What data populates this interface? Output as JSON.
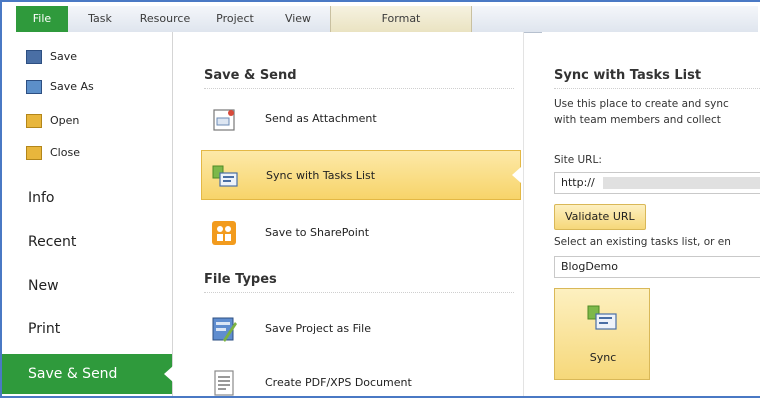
{
  "ribbon": {
    "tabs": [
      "File",
      "Task",
      "Resource",
      "Project",
      "View",
      "Format"
    ]
  },
  "backstage": {
    "commands": [
      {
        "label": "Save",
        "icon": "save-icon"
      },
      {
        "label": "Save As",
        "icon": "save-as-icon"
      },
      {
        "label": "Open",
        "icon": "open-folder-icon"
      },
      {
        "label": "Close",
        "icon": "close-folder-icon"
      }
    ],
    "nav": [
      "Info",
      "Recent",
      "New",
      "Print",
      "Save & Send"
    ],
    "active_nav": "Save & Send"
  },
  "save_send": {
    "title": "Save & Send",
    "options": [
      {
        "label": "Send as Attachment",
        "icon": "attachment-icon"
      },
      {
        "label": "Sync with Tasks List",
        "icon": "sync-tasks-icon"
      },
      {
        "label": "Save to SharePoint",
        "icon": "sharepoint-icon"
      }
    ]
  },
  "file_types": {
    "title": "File Types",
    "options": [
      {
        "label": "Save Project as File",
        "icon": "save-project-icon"
      },
      {
        "label": "Create PDF/XPS Document",
        "icon": "pdf-document-icon"
      }
    ]
  },
  "sync_panel": {
    "title": "Sync with Tasks List",
    "description_line1": "Use this place to create and sync",
    "description_line2": "with team members and collect",
    "site_url_label": "Site URL:",
    "site_url_value": "http://",
    "validate_button": "Validate URL",
    "tasks_list_label": "Select an existing tasks list, or en",
    "tasks_list_value": "BlogDemo",
    "sync_button": "Sync"
  },
  "colors": {
    "accent_green": "#2f9a3c",
    "highlight_gold": "#f7d46a",
    "frame_blue": "#4a79c4"
  }
}
